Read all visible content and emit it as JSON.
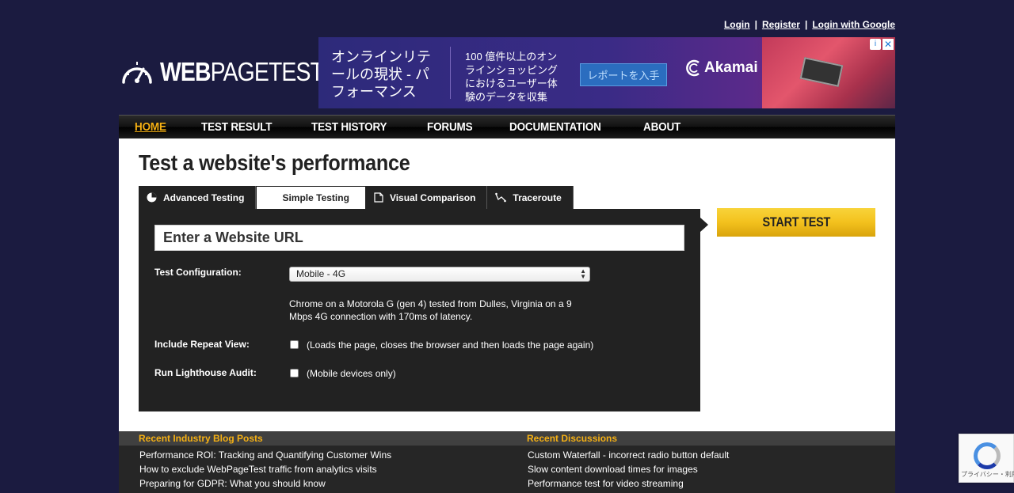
{
  "header": {
    "links": {
      "login": "Login",
      "register": "Register",
      "login_google": "Login with Google",
      "separator": "|"
    },
    "logo": {
      "bold": "WEB",
      "normal": "PAGETEST"
    }
  },
  "ad": {
    "headline": "オンラインリテールの現状 - パフォーマンス",
    "body": "100 億件以上のオンラインショッピングにおけるユーザー体験のデータを収集",
    "button": "レポートを入手",
    "brand": "Akamai",
    "info": "i",
    "close": "✕"
  },
  "nav": {
    "items": [
      "HOME",
      "TEST RESULT",
      "TEST HISTORY",
      "FORUMS",
      "DOCUMENTATION",
      "ABOUT"
    ],
    "active_color": "#f5b014"
  },
  "main": {
    "title": "Test a website's performance",
    "tabs": [
      {
        "label": "Advanced Testing",
        "icon": "gauge-icon"
      },
      {
        "label": "Simple Testing",
        "icon": ""
      },
      {
        "label": "Visual Comparison",
        "icon": "document-icon"
      },
      {
        "label": "Traceroute",
        "icon": "route-icon"
      }
    ],
    "url_placeholder": "Enter a Website URL",
    "config_label": "Test Configuration:",
    "config_value": "Mobile - 4G",
    "config_desc": "Chrome on a Motorola G (gen 4) tested from Dulles, Virginia on a 9 Mbps 4G connection with 170ms of latency.",
    "repeat_label": "Include Repeat View:",
    "repeat_desc": "(Loads the page, closes the browser and then loads the page again)",
    "lighthouse_label": "Run Lighthouse Audit:",
    "lighthouse_desc": "(Mobile devices only)",
    "start_button": "START TEST"
  },
  "lists": {
    "blog_title": "Recent Industry Blog Posts",
    "blog": [
      "Performance ROI: Tracking and Quantifying Customer Wins",
      "How to exclude WebPageTest traffic from analytics visits",
      "Preparing for GDPR: What you should know"
    ],
    "disc_title": "Recent Discussions",
    "discussions": [
      "Custom Waterfall - incorrect radio button default",
      "Slow content download times for images",
      "Performance test for video streaming"
    ]
  },
  "recaptcha": {
    "text": "プライバシー・利用規約"
  },
  "colors": {
    "background": "#1b1b40",
    "accent": "#f5b014",
    "panel": "#222222"
  }
}
